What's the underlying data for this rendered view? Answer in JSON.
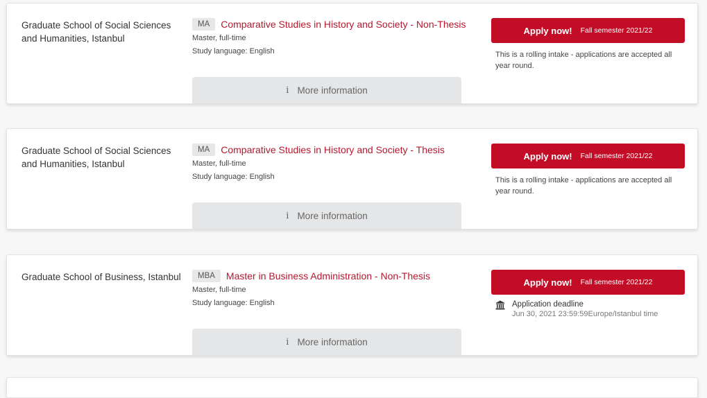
{
  "colors": {
    "accent": "#c30d27",
    "title": "#b5182d",
    "badge_bg": "#e6e7e8",
    "more_info_bg": "#e5e6e7"
  },
  "icons": {
    "info": "info-icon",
    "deadline": "bank-icon"
  },
  "cards": [
    {
      "school": "Graduate School of Social Sciences and Humanities, Istanbul",
      "degree": "MA",
      "title": "Comparative Studies in History and Society - Non-Thesis",
      "mode": "Master, full-time",
      "language": "Study language: English",
      "apply_label": "Apply now!",
      "semester": "Fall semester 2021/22",
      "note": "This is a rolling intake - applications are accepted all year round.",
      "more_info": "More information"
    },
    {
      "school": "Graduate School of Social Sciences and Humanities, Istanbul",
      "degree": "MA",
      "title": "Comparative Studies in History and Society - Thesis",
      "mode": "Master, full-time",
      "language": "Study language: English",
      "apply_label": "Apply now!",
      "semester": "Fall semester 2021/22",
      "note": "This is a rolling intake - applications are accepted all year round.",
      "more_info": "More information"
    },
    {
      "school": "Graduate School of Business, Istanbul",
      "degree": "MBA",
      "title": "Master in Business Administration - Non-Thesis",
      "mode": "Master, full-time",
      "language": "Study language: English",
      "apply_label": "Apply now!",
      "semester": "Fall semester 2021/22",
      "deadline_label": "Application deadline",
      "deadline_value": "Jun 30, 2021 23:59:59Europe/Istanbul time",
      "more_info": "More information"
    }
  ]
}
